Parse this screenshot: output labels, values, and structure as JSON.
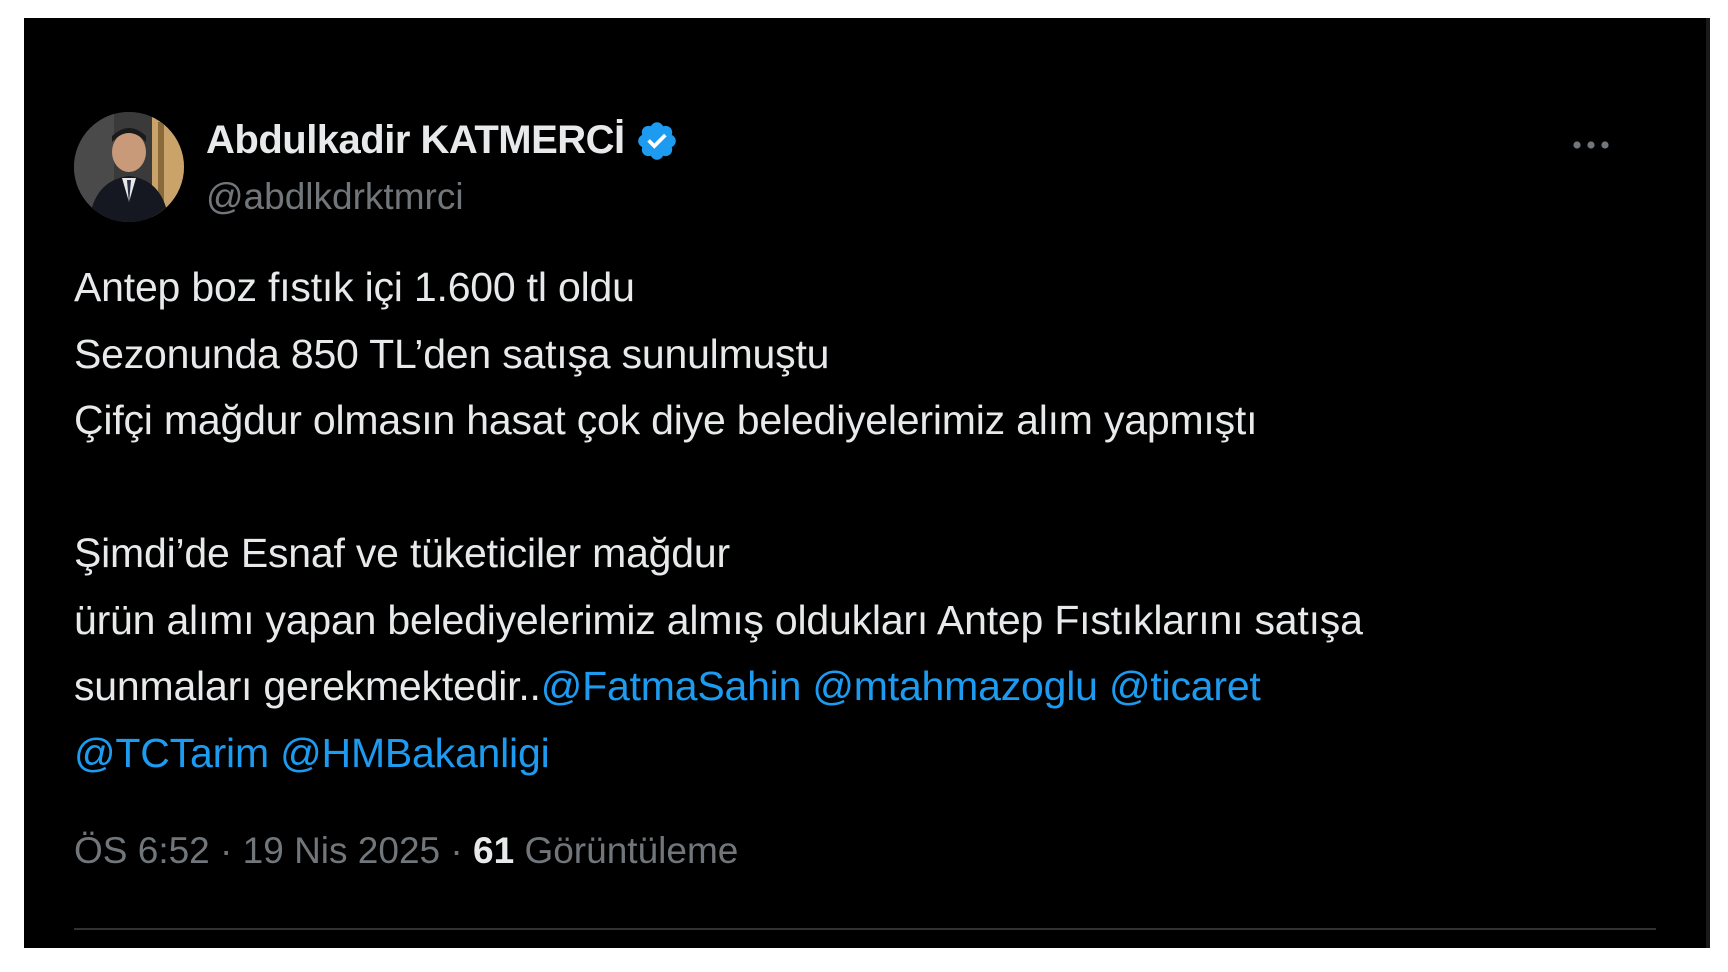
{
  "author": {
    "display_name": "Abdulkadir KATMERCİ",
    "handle": "@abdlkdrktmrci",
    "verified": true,
    "verified_icon": "verified-badge-icon",
    "verified_color": "#1d9bf0"
  },
  "tweet": {
    "lines": [
      "Antep boz fıstık içi 1.600 tl oldu",
      "Sezonunda 850 TL’den satışa sunulmuştu",
      "Çifçi mağdur olmasın hasat çok diye belediyelerimiz alım yapmıştı",
      "",
      "Şimdi’de Esnaf ve tüketiciler mağdur",
      "ürün alımı yapan belediyelerimiz almış oldukları Antep Fıstıklarını satışa"
    ],
    "last_line_text": "sunmaları gerekmektedir..",
    "mentions_line1": [
      "@FatmaSahin",
      "@mtahmazoglu",
      "@ticaret"
    ],
    "mentions_line2": [
      "@TCTarim",
      "@HMBakanligi"
    ],
    "mention_color": "#1d9bf0"
  },
  "meta": {
    "time": "ÖS 6:52",
    "separator": "·",
    "date": "19 Nis 2025",
    "views_count": "61",
    "views_label": "Görüntüleme"
  },
  "more_icon": "more-horizontal-icon"
}
